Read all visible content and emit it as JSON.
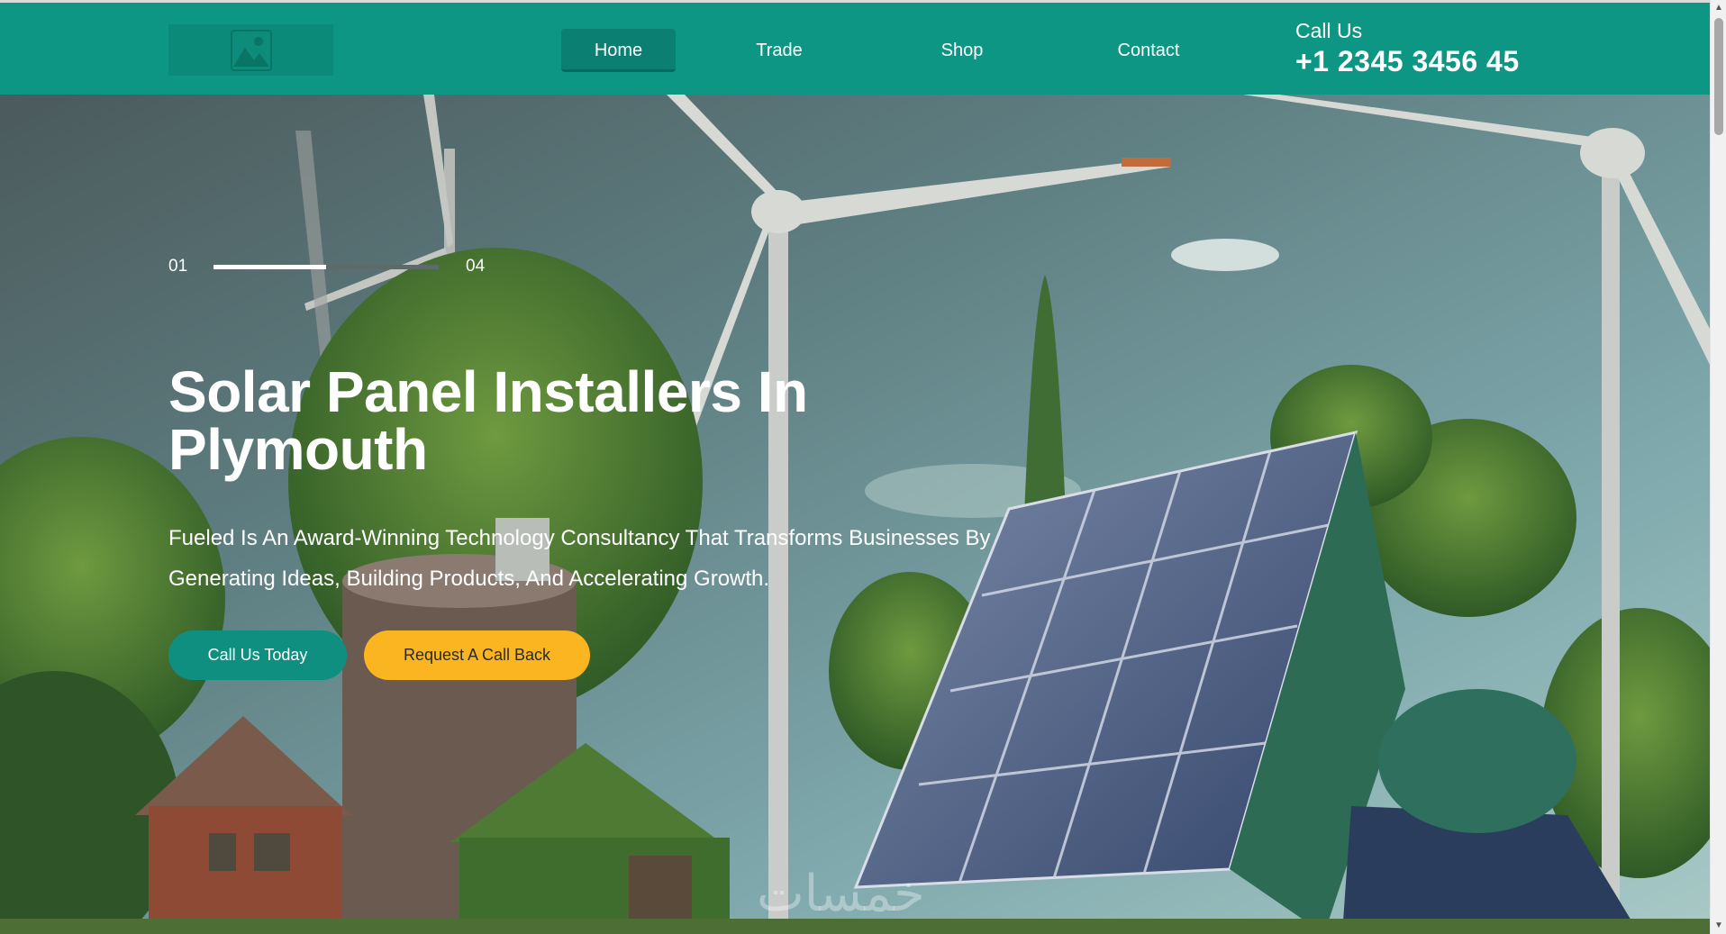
{
  "nav": {
    "items": [
      {
        "label": "Home",
        "active": true
      },
      {
        "label": "Trade",
        "active": false
      },
      {
        "label": "Shop",
        "active": false
      },
      {
        "label": "Contact",
        "active": false
      }
    ]
  },
  "contact": {
    "label": "Call Us",
    "phone": "+1 2345 3456 45"
  },
  "hero": {
    "slider": {
      "current": "01",
      "total": "04",
      "progress": 0.5
    },
    "title": "Solar Panel Installers In Plymouth",
    "description": "Fueled Is An Award-Winning Technology Consultancy That Transforms Businesses By Generating Ideas, Building Products, And Accelerating Growth.",
    "primary_button": "Call Us Today",
    "secondary_button": "Request A Call Back",
    "watermark": "خمسات"
  },
  "icons": {
    "logo": "image-placeholder-icon",
    "scroll_up": "triangle-up-icon",
    "scroll_down": "triangle-down-icon"
  },
  "colors": {
    "header": "#0e9685",
    "primary": "#0e8f80",
    "accent": "#fbb520"
  }
}
